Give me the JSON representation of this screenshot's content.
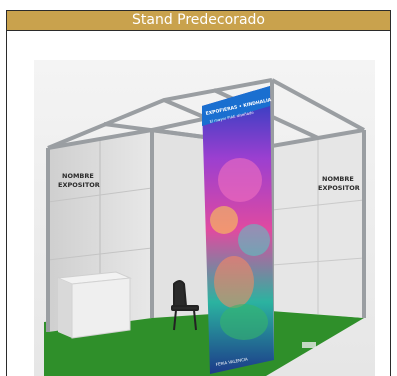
{
  "header": {
    "title": "Stand Predecorado"
  },
  "stand": {
    "left_wall_sign": [
      "NOMBRE",
      "EXPOSITOR"
    ],
    "right_wall_sign": [
      "NOMBRE",
      "EXPOSITOR"
    ],
    "banner_heading": "EXPOFIERAS • KINDHALIA",
    "banner_subheading": "El mayor FIAE diseñado",
    "banner_footer": "FERIA VALENCIA"
  },
  "colors": {
    "header_bg": "#c9a24d",
    "header_text": "#ffffff",
    "floor": "#2f8f2a",
    "wall": "#dcdcdc",
    "frame": "#9a9ea2"
  }
}
